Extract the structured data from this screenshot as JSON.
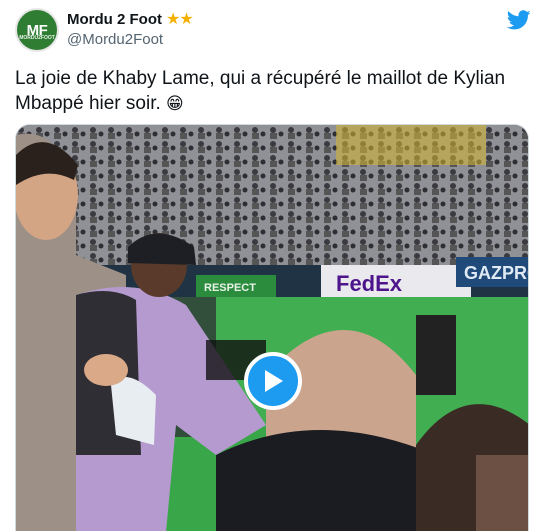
{
  "tweet": {
    "display_name": "Mordu 2 Foot",
    "badge": "★★",
    "handle": "@Mordu2Foot",
    "avatar_initials": "MF",
    "avatar_sub": "MORDU2FOOT",
    "text": "La joie de Khaby Lame, qui a récupéré le maillot de Kylian Mbappé hier soir.",
    "emoji": "😁"
  },
  "media": {
    "boards": {
      "respect": "RESPECT",
      "fedex": "FedEx",
      "gazprom": "GAZPRO"
    },
    "play_icon": "play-icon"
  },
  "icons": {
    "brand": "twitter-bird-icon"
  },
  "colors": {
    "accent": "#1d9bf0",
    "pitch": "#3aa64a"
  }
}
